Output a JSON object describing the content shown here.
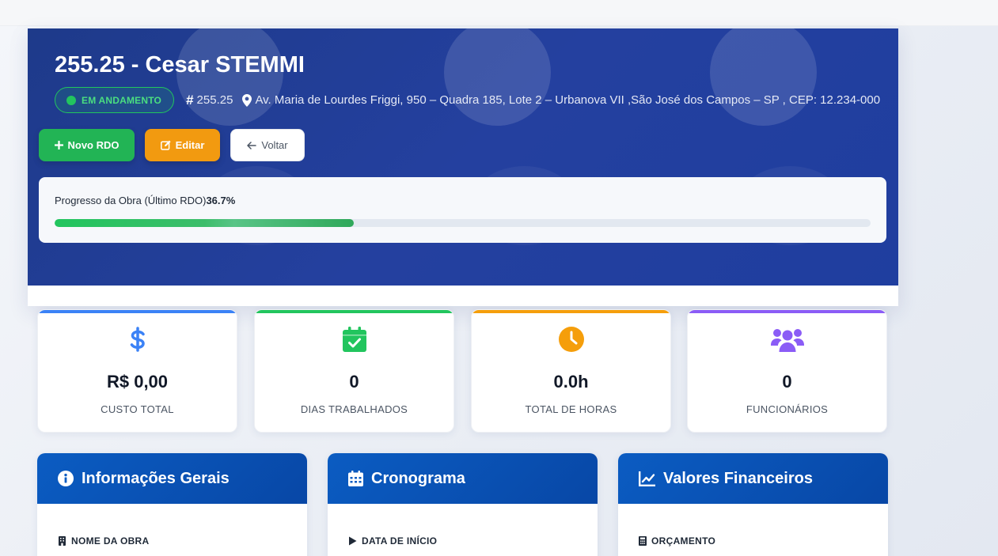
{
  "project": {
    "title": "255.25 - Cesar STEMMI",
    "status": "EM ANDAMENTO",
    "code": "255.25",
    "address": "Av. Maria de Lourdes Friggi, 950 – Quadra 185, Lote 2 – Urbanova VII ,São José dos Campos – SP , CEP: 12.234-000"
  },
  "actions": {
    "new_rdo": "Novo RDO",
    "edit": "Editar",
    "back": "Voltar"
  },
  "progress": {
    "label": "Progresso da Obra (Último RDO)",
    "value_text": "36.7%",
    "value": 36.7
  },
  "stats": [
    {
      "icon": "dollar-icon",
      "value": "R$ 0,00",
      "label": "CUSTO TOTAL",
      "color": "#3b82f6"
    },
    {
      "icon": "calendar-check-icon",
      "value": "0",
      "label": "DIAS TRABALHADOS",
      "color": "#22c55e"
    },
    {
      "icon": "clock-icon",
      "value": "0.0h",
      "label": "TOTAL DE HORAS",
      "color": "#f59e0b"
    },
    {
      "icon": "users-icon",
      "value": "0",
      "label": "FUNCIONÁRIOS",
      "color": "#8b5cf6"
    }
  ],
  "panels": [
    {
      "icon": "info-icon",
      "title": "Informações Gerais",
      "field_icon": "building-icon",
      "field_label": "NOME DA OBRA"
    },
    {
      "icon": "calendar-icon",
      "title": "Cronograma",
      "field_icon": "play-icon",
      "field_label": "DATA DE INÍCIO"
    },
    {
      "icon": "chart-line-icon",
      "title": "Valores Financeiros",
      "field_icon": "calculator-icon",
      "field_label": "ORÇAMENTO"
    }
  ],
  "colors": {
    "hero_bg": "#1e3a8a",
    "success": "#22c55e",
    "warning": "#f29a10",
    "panel_header": "#0b5cc2"
  }
}
